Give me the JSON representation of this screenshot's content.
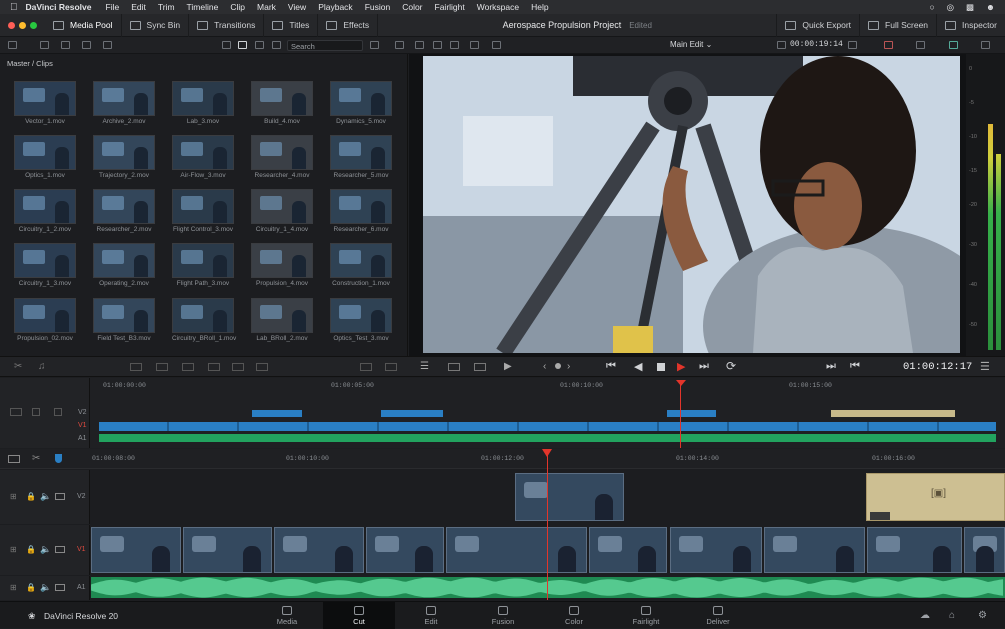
{
  "menubar": {
    "app_name": "DaVinci Resolve",
    "items": [
      "File",
      "Edit",
      "Trim",
      "Timeline",
      "Clip",
      "Mark",
      "View",
      "Playback",
      "Fusion",
      "Color",
      "Fairlight",
      "Workspace",
      "Help"
    ]
  },
  "toolbar": {
    "media_pool": "Media Pool",
    "sync_bin": "Sync Bin",
    "transitions": "Transitions",
    "titles": "Titles",
    "effects": "Effects",
    "project_title": "Aerospace Propulsion Project",
    "status": "Edited",
    "quick_export": "Quick Export",
    "full_screen": "Full Screen",
    "inspector": "Inspector"
  },
  "subbar": {
    "search_placeholder": "Search",
    "timeline_name": "Main Edit",
    "timecode": "00:00:19:14"
  },
  "pool": {
    "breadcrumb": "Master / Clips",
    "clips": [
      "Vector_1.mov",
      "Archive_2.mov",
      "Lab_3.mov",
      "Build_4.mov",
      "Dynamics_5.mov",
      "Optics_1.mov",
      "Trajectory_2.mov",
      "Air-Flow_3.mov",
      "Researcher_4.mov",
      "Researcher_5.mov",
      "Circuitry_1_2.mov",
      "Researcher_2.mov",
      "Flight Control_3.mov",
      "Circuitry_1_4.mov",
      "Researcher_6.mov",
      "Circuitry_1_3.mov",
      "Operating_2.mov",
      "Flight Path_3.mov",
      "Propulsion_4.mov",
      "Construction_1.mov",
      "Propulsion_02.mov",
      "Field Test_B3.mov",
      "Circuitry_BRoll_1.mov",
      "Lab_BRoll_2.mov",
      "Optics_Test_3.mov"
    ]
  },
  "transport": {
    "timecode": "01:00:12:17"
  },
  "upper_timeline": {
    "ticks": [
      "01:00:00:00",
      "01:00:05:00",
      "01:00:10:00",
      "01:00:15:00"
    ],
    "track_labels": [
      "V2",
      "V1",
      "A1"
    ]
  },
  "lower_timeline": {
    "ticks": [
      "01:00:08:00",
      "01:00:10:00",
      "01:00:12:00",
      "01:00:14:00",
      "01:00:16:00"
    ],
    "track_labels": [
      "V2",
      "V1",
      "A1"
    ]
  },
  "meters": {
    "scale": [
      "0",
      "-5",
      "-10",
      "-15",
      "-20",
      "-30",
      "-40",
      "-50"
    ]
  },
  "pages": {
    "brand": "DaVinci Resolve 20",
    "items": [
      "Media",
      "Cut",
      "Edit",
      "Fusion",
      "Color",
      "Fairlight",
      "Deliver"
    ],
    "active": "Cut"
  },
  "colors": {
    "video_track": "#2a7fc4",
    "audio_track": "#22a35f",
    "title_clip": "#c7b98a",
    "playhead": "#e2352b",
    "active_page": "#0c0d0e"
  }
}
